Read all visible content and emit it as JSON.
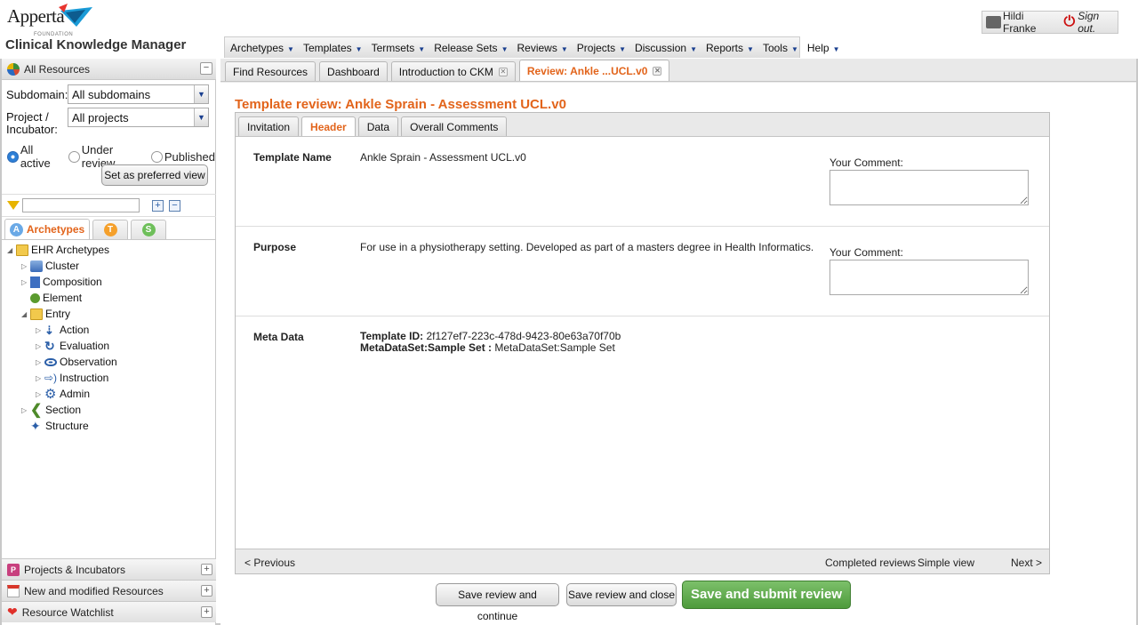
{
  "brand": {
    "logo_text": "Apperta",
    "logo_sub": "FOUNDATION",
    "app_title": "Clinical Knowledge Manager"
  },
  "menu": [
    "Archetypes",
    "Templates",
    "Termsets",
    "Release Sets",
    "Reviews",
    "Projects",
    "Discussion",
    "Reports",
    "Tools",
    "Help"
  ],
  "user": {
    "name": "Hildi Franke",
    "signout": "Sign out."
  },
  "left": {
    "header": "All Resources",
    "subdomain_label": "Subdomain:",
    "subdomain_value": "All subdomains",
    "project_label_1": "Project /",
    "project_label_2": "Incubator:",
    "project_value": "All projects",
    "radios": [
      "All active",
      "Under review",
      "Published"
    ],
    "radio_selected": "All active",
    "preferred_button": "Set as preferred view",
    "resource_tab_active": "Archetypes",
    "badge_letters": [
      "A",
      "T",
      "S"
    ],
    "tree": {
      "root": "EHR Archetypes",
      "cluster": "Cluster",
      "composition": "Composition",
      "element": "Element",
      "entry": "Entry",
      "action": "Action",
      "evaluation": "Evaluation",
      "observation": "Observation",
      "instruction": "Instruction",
      "admin": "Admin",
      "section": "Section",
      "structure": "Structure"
    },
    "footer": [
      "Projects & Incubators",
      "New and modified Resources",
      "Resource Watchlist"
    ]
  },
  "tabs": {
    "find": "Find Resources",
    "dashboard": "Dashboard",
    "intro": "Introduction to CKM",
    "review": "Review: Ankle ...UCL.v0"
  },
  "review": {
    "title": "Template review: Ankle Sprain - Assessment UCL.v0",
    "subtabs": [
      "Invitation",
      "Header",
      "Data",
      "Overall Comments"
    ],
    "active_subtab": "Header",
    "template_name_label": "Template Name",
    "template_name_value": "Ankle Sprain - Assessment UCL.v0",
    "purpose_label": "Purpose",
    "purpose_value": "For use in a physiotherapy setting. Developed as part of a masters degree in Health Informatics.",
    "comment_label": "Your Comment:",
    "meta_label": "Meta Data",
    "meta_template_id_label": "Template ID:",
    "meta_template_id_value": "2f127ef7-223c-478d-9423-80e63a70f70b",
    "meta_set_label": "MetaDataSet:Sample Set :",
    "meta_set_value": "MetaDataSet:Sample Set",
    "prev": "< Previous",
    "completed": "Completed reviews",
    "simple": "Simple view",
    "next": "Next >"
  },
  "actions": {
    "continue": "Save review and continue",
    "close": "Save review and close",
    "submit": "Save and submit review"
  },
  "colors": {
    "accent_orange": "#e2641b",
    "green": "#5aa648",
    "nav_blue": "#1a3f8f"
  }
}
